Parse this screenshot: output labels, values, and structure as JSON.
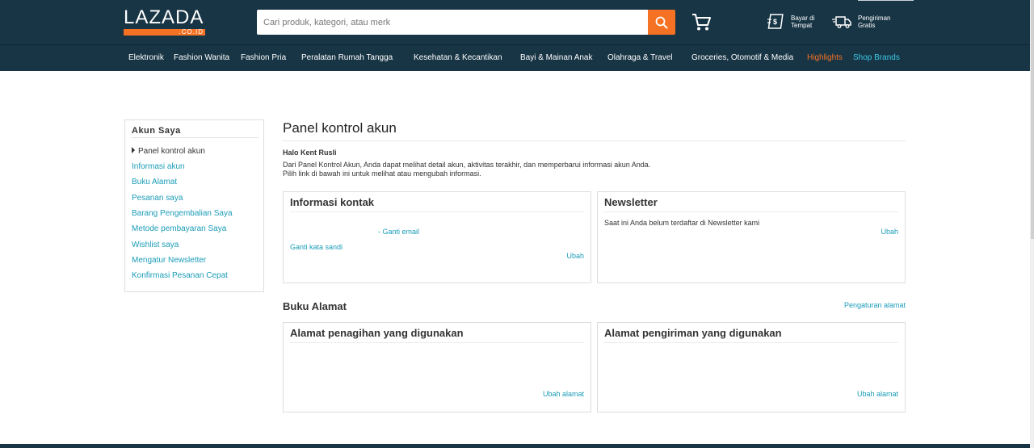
{
  "header": {
    "logo": {
      "main": "LAZADA",
      "sub": ".CO.ID"
    },
    "search": {
      "placeholder": "Cari produk, kategori, atau merk",
      "value": ""
    },
    "icons": {
      "search": "search-icon",
      "cart": "cart-icon",
      "cod": "cash-on-delivery-icon",
      "shipping": "truck-icon"
    },
    "links": [
      {
        "label_line1": "Bayar di",
        "label_line2": "Tempat"
      },
      {
        "label_line1": "Pengiriman",
        "label_line2": "Gratis"
      }
    ],
    "colors": {
      "background": "#183545",
      "accent": "#f57224",
      "link": "#1a9cb7",
      "highlight": "#f57224",
      "shop_brands": "#3bc8e7"
    }
  },
  "nav": {
    "items": [
      "Elektronik",
      "Fashion Wanita",
      "Fashion Pria",
      "Peralatan Rumah Tangga",
      "Kesehatan & Kecantikan",
      "Bayi & Mainan Anak",
      "Olahraga & Travel",
      "Groceries, Otomotif & Media",
      "Highlights",
      "Shop Brands"
    ]
  },
  "sidebar": {
    "title": "Akun Saya",
    "items": [
      "Panel kontrol akun",
      "Informasi akun",
      "Buku Alamat",
      "Pesanan saya",
      "Barang Pengembalian Saya",
      "Metode pembayaran Saya",
      "Wishlist saya",
      "Mengatur Newsletter",
      "Konfirmasi Pesanan Cepat"
    ],
    "active_index": 0
  },
  "main": {
    "title": "Panel kontrol akun",
    "greeting": "Halo Kent Rusli",
    "intro_line1": "Dari Panel Kontrol Akun, Anda dapat melihat detail akun, aktivitas terakhir, dan memperbarui informasi akun Anda.",
    "intro_line2": "Pilih link di bawah ini untuk melihat atau mengubah informasi.",
    "contact": {
      "title": "Informasi kontak",
      "change_email": "- Ganti email",
      "change_password": "Ganti kata sandi",
      "edit": "Ubah"
    },
    "newsletter": {
      "title": "Newsletter",
      "status": "Saat ini Anda belum terdaftar di Newsletter kami",
      "edit": "Ubah"
    },
    "address_book": {
      "title": "Buku Alamat",
      "manage": "Pengaturan alamat",
      "billing": {
        "title": "Alamat penagihan yang digunakan",
        "edit": "Ubah alamat"
      },
      "shipping": {
        "title": "Alamat pengiriman yang digunakan",
        "edit": "Ubah alamat"
      }
    }
  }
}
